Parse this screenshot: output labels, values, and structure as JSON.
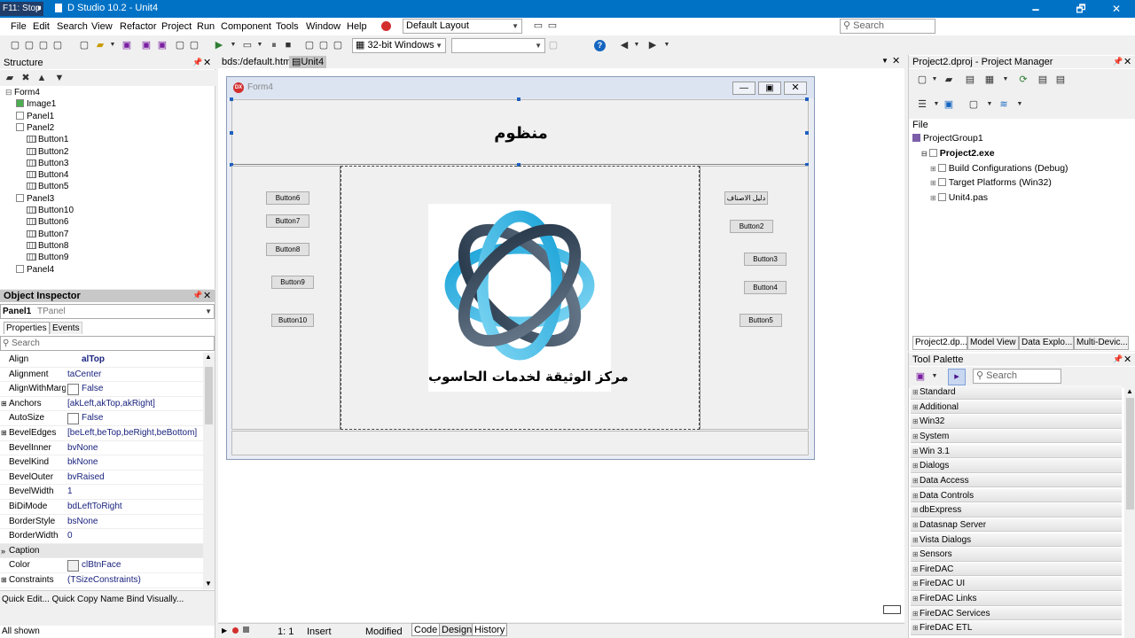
{
  "titlebar": {
    "stop_label": "F11: Stop",
    "title": "D Studio 10.2 - Unit4",
    "minimize": "🗕",
    "restore": "🗗",
    "close": "✕"
  },
  "menu": [
    "File",
    "Edit",
    "Search",
    "View",
    "Refactor",
    "Project",
    "Run",
    "Component",
    "Tools",
    "Window",
    "Help"
  ],
  "layout_combo": "Default Layout",
  "platform_combo": "32-bit Windows",
  "search_placeholder": "Search",
  "structure": {
    "title": "Structure",
    "items": [
      {
        "label": "Form4",
        "indent": 0
      },
      {
        "label": "Image1",
        "indent": 1
      },
      {
        "label": "Panel1",
        "indent": 1
      },
      {
        "label": "Panel2",
        "indent": 1
      },
      {
        "label": "Button1",
        "indent": 2
      },
      {
        "label": "Button2",
        "indent": 2
      },
      {
        "label": "Button3",
        "indent": 2
      },
      {
        "label": "Button4",
        "indent": 2
      },
      {
        "label": "Button5",
        "indent": 2
      },
      {
        "label": "Panel3",
        "indent": 1
      },
      {
        "label": "Button10",
        "indent": 2
      },
      {
        "label": "Button6",
        "indent": 2
      },
      {
        "label": "Button7",
        "indent": 2
      },
      {
        "label": "Button8",
        "indent": 2
      },
      {
        "label": "Button9",
        "indent": 2
      },
      {
        "label": "Panel4",
        "indent": 1
      }
    ]
  },
  "inspector": {
    "title": "Object Inspector",
    "object": "Panel1",
    "type": "TPanel",
    "tab_properties": "Properties",
    "tab_events": "Events",
    "search": "Search",
    "rows": [
      {
        "n": "Align",
        "v": "alTop",
        "bold": true
      },
      {
        "n": "Alignment",
        "v": "taCenter"
      },
      {
        "n": "AlignWithMargins",
        "v": "False",
        "check": true
      },
      {
        "n": "Anchors",
        "v": "[akLeft,akTop,akRight]",
        "exp": true
      },
      {
        "n": "AutoSize",
        "v": "False",
        "check": true
      },
      {
        "n": "BevelEdges",
        "v": "[beLeft,beTop,beRight,beBottom]",
        "exp": true
      },
      {
        "n": "BevelInner",
        "v": "bvNone"
      },
      {
        "n": "BevelKind",
        "v": "bkNone"
      },
      {
        "n": "BevelOuter",
        "v": "bvRaised"
      },
      {
        "n": "BevelWidth",
        "v": "1"
      },
      {
        "n": "BiDiMode",
        "v": "bdLeftToRight"
      },
      {
        "n": "BorderStyle",
        "v": "bsNone"
      },
      {
        "n": "BorderWidth",
        "v": "0"
      },
      {
        "n": "Caption",
        "v": "",
        "sel": true
      },
      {
        "n": "Color",
        "v": "clBtnFace",
        "swatch": true
      },
      {
        "n": "Constraints",
        "v": "(TSizeConstraints)",
        "exp": true
      }
    ],
    "quick": "Quick Edit...  Quick Copy Name  Bind Visually...",
    "status": "All shown"
  },
  "editor": {
    "tab1": "bds:/default.htm",
    "tab2": "Unit4",
    "status_pos": "1:   1",
    "status_mode": "Insert",
    "status_mod": "Modified",
    "tab_code": "Code",
    "tab_design": "Design",
    "tab_history": "History"
  },
  "form": {
    "caption": "Form4",
    "header_text": "منظوم",
    "logo_caption": "مركز الوثيقة لخدمات الحاسوب",
    "left_buttons": [
      {
        "label": "Button6",
        "l": 299,
        "t": 215,
        "w": 49
      },
      {
        "label": "Button7",
        "l": 299,
        "t": 241,
        "w": 49
      },
      {
        "label": "Button8",
        "l": 299,
        "t": 273,
        "w": 49
      },
      {
        "label": "Button9",
        "l": 305,
        "t": 310,
        "w": 48
      },
      {
        "label": "Button10",
        "l": 305,
        "t": 353,
        "w": 48
      }
    ],
    "right_buttons": [
      {
        "label": "دليل الاصناف",
        "l": 816,
        "t": 215,
        "w": 49
      },
      {
        "label": "Button2",
        "l": 822,
        "t": 247,
        "w": 49
      },
      {
        "label": "Button3",
        "l": 838,
        "t": 284,
        "w": 48
      },
      {
        "label": "Button4",
        "l": 838,
        "t": 316,
        "w": 48
      },
      {
        "label": "Button5",
        "l": 833,
        "t": 353,
        "w": 48
      }
    ]
  },
  "project_manager": {
    "title": "Project2.dproj - Project Manager",
    "file_label": "File",
    "items": [
      {
        "label": "ProjectGroup1",
        "indent": 0
      },
      {
        "label": "Project2.exe",
        "indent": 1,
        "bold": true
      },
      {
        "label": "Build Configurations (Debug)",
        "indent": 2
      },
      {
        "label": "Target Platforms (Win32)",
        "indent": 2
      },
      {
        "label": "Unit4.pas",
        "indent": 2
      }
    ],
    "tabs": [
      "Project2.dp...",
      "Model View",
      "Data Explo...",
      "Multi-Devic..."
    ]
  },
  "palette": {
    "title": "Tool Palette",
    "search": "Search",
    "categories": [
      "Standard",
      "Additional",
      "Win32",
      "System",
      "Win 3.1",
      "Dialogs",
      "Data Access",
      "Data Controls",
      "dbExpress",
      "Datasnap Server",
      "Vista Dialogs",
      "Sensors",
      "FireDAC",
      "FireDAC UI",
      "FireDAC Links",
      "FireDAC Services",
      "FireDAC ETL"
    ]
  }
}
